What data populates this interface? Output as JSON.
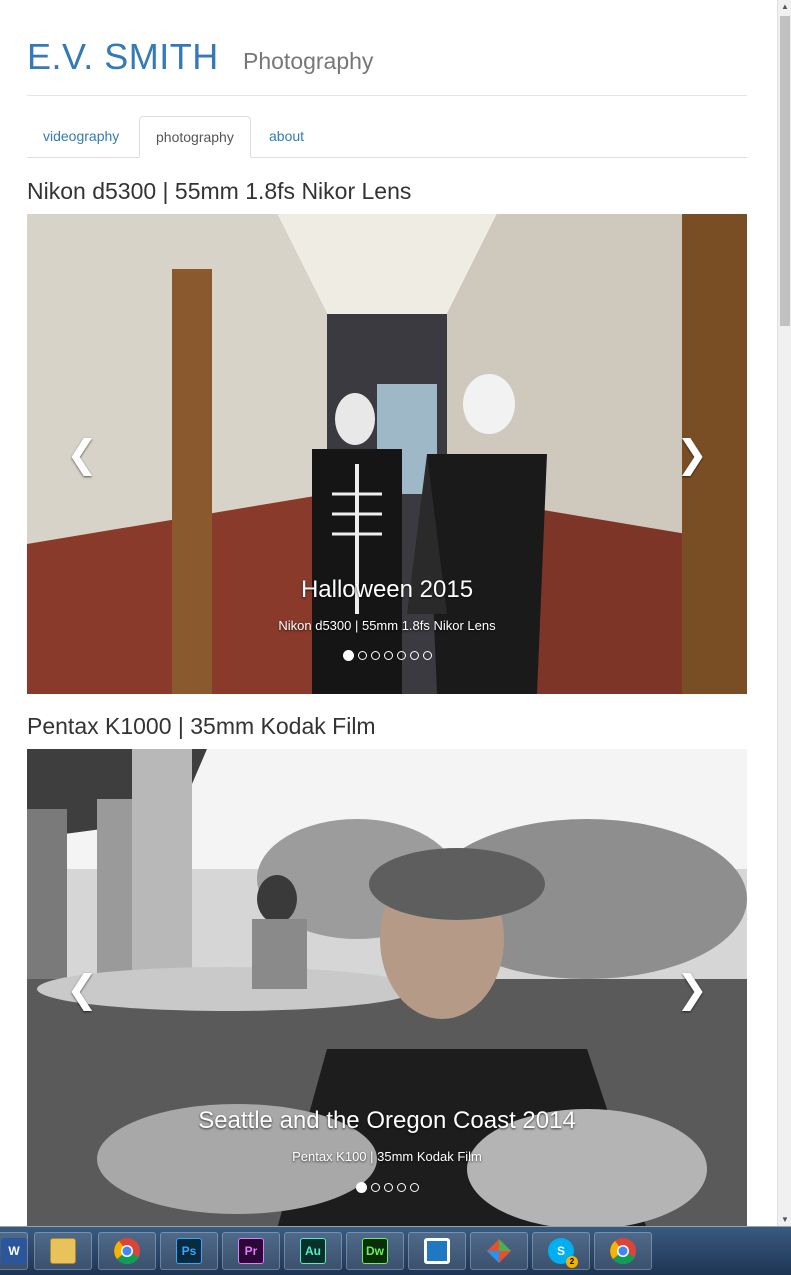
{
  "brand": {
    "name": "E.V. SMITH",
    "subtitle": "Photography"
  },
  "tabs": [
    {
      "label": "videography",
      "active": false
    },
    {
      "label": "photography",
      "active": true
    },
    {
      "label": "about",
      "active": false
    }
  ],
  "galleries": [
    {
      "title": "Nikon d5300 | 55mm 1.8fs Nikor Lens",
      "caption_title": "Halloween 2015",
      "caption_sub": "Nikon d5300 | 55mm 1.8fs Nikor Lens",
      "slide_count": 7,
      "active_slide": 1,
      "prev_icon": "chevron-left-icon",
      "next_icon": "chevron-right-icon"
    },
    {
      "title": "Pentax K1000 | 35mm Kodak Film",
      "caption_title": "Seattle and the Oregon Coast 2014",
      "caption_sub": "Pentax K100 | 35mm Kodak Film",
      "slide_count": 5,
      "active_slide": 1,
      "prev_icon": "chevron-left-icon",
      "next_icon": "chevron-right-icon"
    }
  ],
  "taskbar": {
    "apps": [
      "word-icon",
      "file-explorer-icon",
      "chrome-icon",
      "photoshop-icon",
      "premiere-icon",
      "audition-icon",
      "dreamweaver-icon",
      "window-app-icon",
      "git-icon",
      "skype-icon",
      "chrome-icon"
    ],
    "labels": {
      "ps": "Ps",
      "pr": "Pr",
      "au": "Au",
      "dw": "Dw",
      "skype_badge": "2"
    }
  },
  "colors": {
    "link": "#337ab7",
    "muted": "#777777",
    "text": "#333333"
  }
}
